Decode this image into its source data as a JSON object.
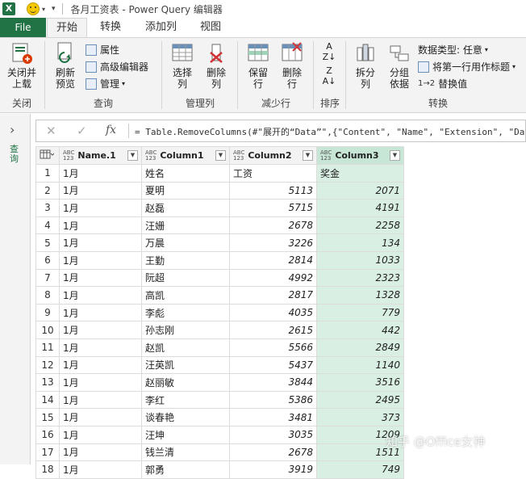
{
  "titlebar": {
    "app_icon": "X",
    "sep": "|",
    "title": "各月工资表 - Power Query 编辑器"
  },
  "tabs": {
    "file": "File",
    "home": "开始",
    "transform": "转换",
    "add_column": "添加列",
    "view": "视图"
  },
  "ribbon": {
    "close_load": "关闭并\n上载",
    "refresh_preview": "刷新\n预览",
    "properties": "属性",
    "advanced_editor": "高级编辑器",
    "manage": "管理",
    "choose_columns": "选择\n列",
    "remove_columns": "删除\n列",
    "keep_rows": "保留\n行",
    "remove_rows": "删除\n行",
    "split_column": "拆分\n列",
    "group_by": "分组\n依据",
    "data_type": "数据类型: 任意",
    "use_first_row": "将第一行用作标题",
    "replace_values": "替换值",
    "groups": {
      "close": "关闭",
      "query": "查询",
      "manage_columns": "管理列",
      "reduce_rows": "减少行",
      "sort": "排序",
      "transform": "转换"
    }
  },
  "leftpane": {
    "label": "查询"
  },
  "formula": {
    "text": "= Table.RemoveColumns(#\"展开的“Data”\",{\"Content\", \"Name\", \"Extension\", \"Da"
  },
  "columns": [
    {
      "type": "ABC\n123",
      "name": "Name.1"
    },
    {
      "type": "ABC\n123",
      "name": "Column1"
    },
    {
      "type": "ABC\n123",
      "name": "Column2"
    },
    {
      "type": "ABC\n123",
      "name": "Column3"
    }
  ],
  "rows": [
    [
      "1",
      "1月",
      "姓名",
      "工资",
      "奖金"
    ],
    [
      "2",
      "1月",
      "夏明",
      "5113",
      "2071"
    ],
    [
      "3",
      "1月",
      "赵磊",
      "5715",
      "4191"
    ],
    [
      "4",
      "1月",
      "汪姗",
      "2678",
      "2258"
    ],
    [
      "5",
      "1月",
      "万晨",
      "3226",
      "134"
    ],
    [
      "6",
      "1月",
      "王勤",
      "2814",
      "1033"
    ],
    [
      "7",
      "1月",
      "阮超",
      "4992",
      "2323"
    ],
    [
      "8",
      "1月",
      "高凯",
      "2817",
      "1328"
    ],
    [
      "9",
      "1月",
      "李彪",
      "4035",
      "779"
    ],
    [
      "10",
      "1月",
      "孙志刚",
      "2615",
      "442"
    ],
    [
      "11",
      "1月",
      "赵凯",
      "5566",
      "2849"
    ],
    [
      "12",
      "1月",
      "汪英凯",
      "5437",
      "1140"
    ],
    [
      "13",
      "1月",
      "赵丽敏",
      "3844",
      "3516"
    ],
    [
      "14",
      "1月",
      "李红",
      "5386",
      "2495"
    ],
    [
      "15",
      "1月",
      "谈春艳",
      "3481",
      "373"
    ],
    [
      "16",
      "1月",
      "汪坤",
      "3035",
      "1209"
    ],
    [
      "17",
      "1月",
      "钱兰清",
      "2678",
      "1511"
    ],
    [
      "18",
      "1月",
      "郭勇",
      "3919",
      "749"
    ]
  ],
  "watermark": "知乎 @Office女神"
}
